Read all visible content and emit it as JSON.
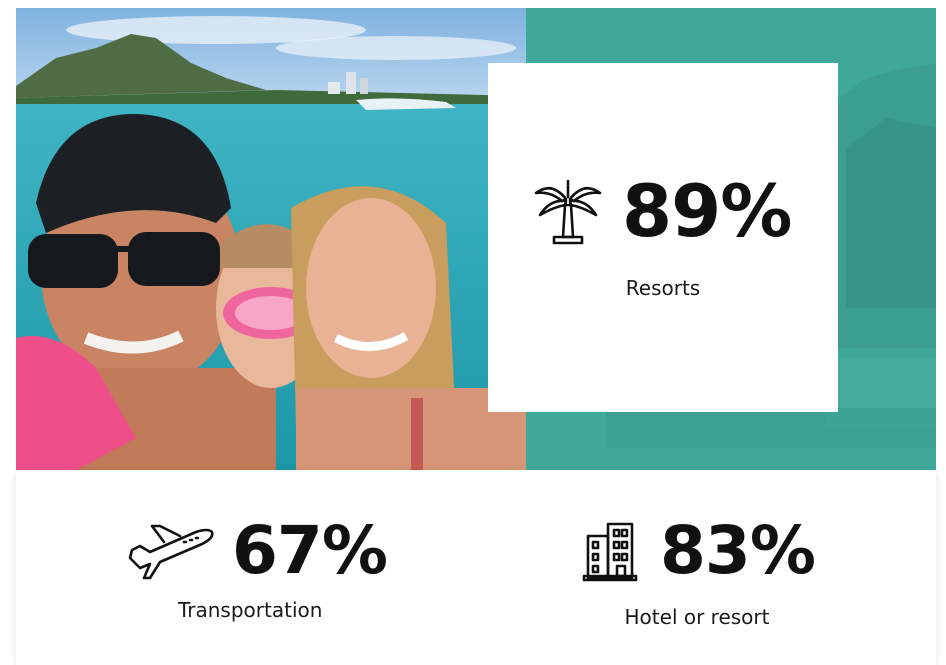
{
  "hero": {
    "image": "family-beach-selfie-photo",
    "accent_color": "#3fa89a"
  },
  "stats": {
    "resorts": {
      "value": "89%",
      "label": "Resorts",
      "icon": "palm-tree-icon"
    },
    "transportation": {
      "value": "67%",
      "label": "Transportation",
      "icon": "airplane-icon"
    },
    "hotel": {
      "value": "83%",
      "label": "Hotel or resort",
      "icon": "building-icon"
    }
  }
}
